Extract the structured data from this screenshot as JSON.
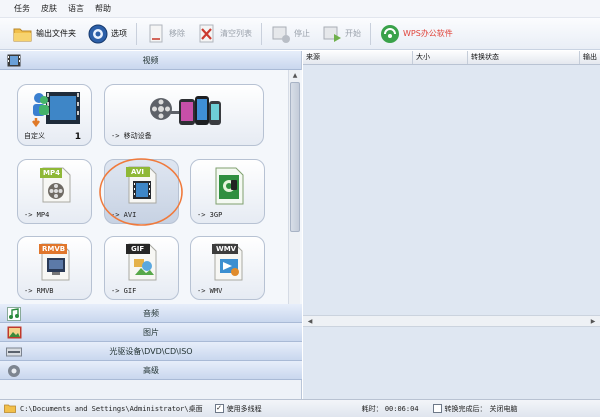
{
  "menu": [
    "任务",
    "皮肤",
    "语言",
    "帮助"
  ],
  "toolbar": {
    "output_folder": "输出文件夹",
    "options": "选项",
    "remove": "移除",
    "clear_list": "清空列表",
    "stop": "停止",
    "start": "开始",
    "wps": "WPS办公软件"
  },
  "categories": {
    "video": "视频",
    "audio": "音频",
    "image": "图片",
    "optical": "光驱设备\\DVD\\CD\\ISO",
    "advanced": "高级"
  },
  "tiles": {
    "custom": {
      "label": "自定义",
      "count": "1"
    },
    "mobile": {
      "label": "-> 移动设备"
    },
    "mp4": {
      "label": "-> MP4",
      "badge": "MP4"
    },
    "avi": {
      "label": "-> AVI",
      "badge": "AVI"
    },
    "gp3": {
      "label": "-> 3GP",
      "badge": "3GP"
    },
    "rmvb": {
      "label": "-> RMVB",
      "badge": "RMVB"
    },
    "gif": {
      "label": "-> GIF",
      "badge": "GIF"
    },
    "wmv": {
      "label": "-> WMV",
      "badge": "WMV"
    }
  },
  "file_list": {
    "columns": [
      "来源",
      "大小",
      "转换状态",
      "输出"
    ]
  },
  "status": {
    "path": "C:\\Documents and Settings\\Administrator\\桌面",
    "multithread_label": "使用多线程",
    "multithread_checked": true,
    "elapsed_label": "耗时：",
    "elapsed": "00:06:04",
    "after_convert_label": "转换完成后：",
    "after_convert_value": "关闭电脑"
  },
  "colors": {
    "selection_ring": "#f07a3c",
    "wps_link": "#e0433a",
    "header_gradient_top": "#e7eefa",
    "header_gradient_bottom": "#c9d7ee"
  }
}
